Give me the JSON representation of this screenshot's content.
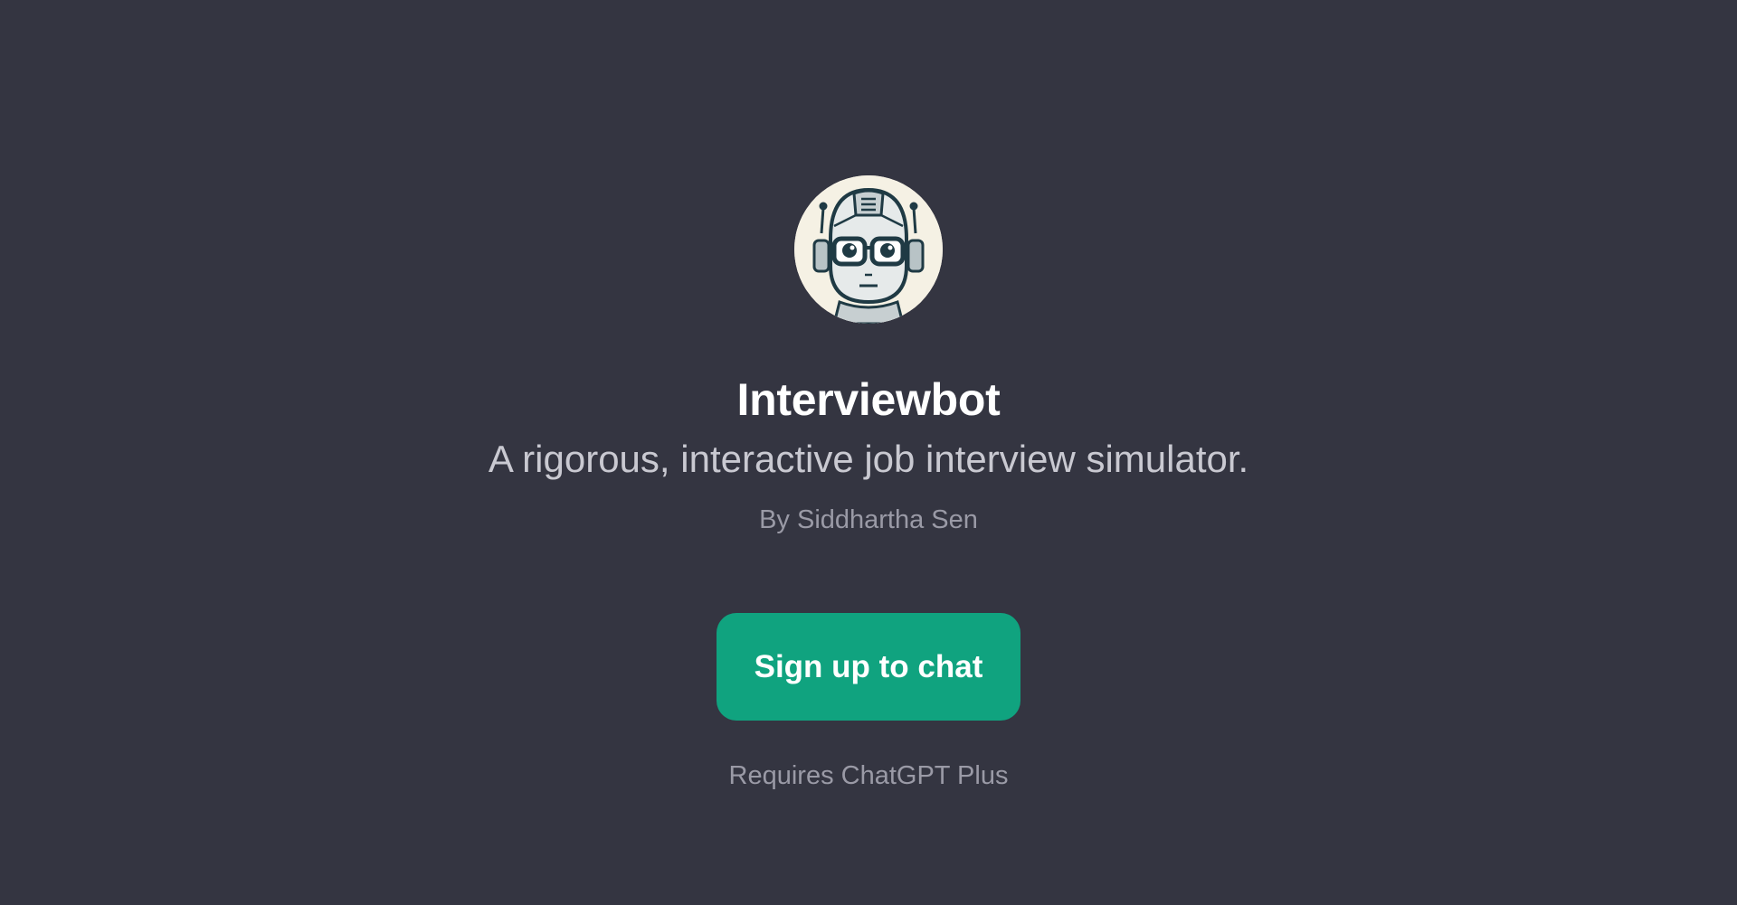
{
  "gpt": {
    "name": "Interviewbot",
    "description": "A rigorous, interactive job interview simulator.",
    "author": "By Siddhartha Sen",
    "avatar_icon": "robot-with-glasses-icon"
  },
  "cta": {
    "label": "Sign up to chat"
  },
  "footer": {
    "requirement": "Requires ChatGPT Plus"
  },
  "colors": {
    "background": "#343541",
    "accent": "#10a37f",
    "avatar_background": "#f5f1e4"
  }
}
